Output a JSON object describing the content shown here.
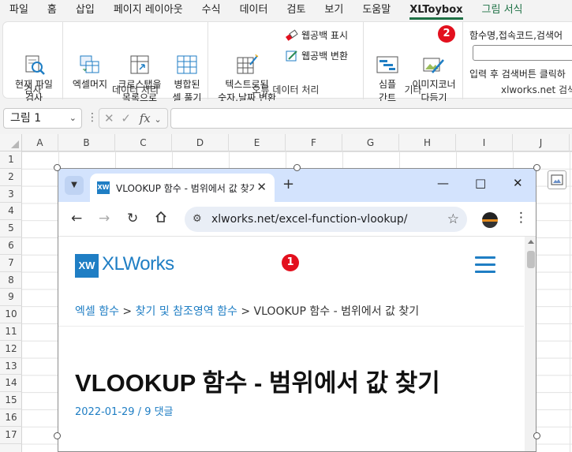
{
  "menu": {
    "items": [
      "파일",
      "홈",
      "삽입",
      "페이지 레이아웃",
      "수식",
      "데이터",
      "검토",
      "보기",
      "도움말",
      "XLToybox",
      "그림 서식"
    ]
  },
  "ribbon": {
    "search_group": {
      "button": "현재 파일\n검사",
      "label": "검사"
    },
    "data_group": {
      "buttons": [
        "엑셀머지",
        "크로스탭을\n목록으로",
        "병합된\n셀 풀기"
      ],
      "label": "데이터 처리"
    },
    "error_group": {
      "big_button": "텍스트로된\n숫자,날짜 변환",
      "small_buttons": [
        "웹공백 표시",
        "웹공백 변환"
      ],
      "label": "오류 데이터 처리"
    },
    "etc_group": {
      "buttons": [
        "심플\n간트",
        "이미지코너\n다듬기"
      ],
      "label": "기타"
    },
    "xlworks_group": {
      "heading": "함수명,접속코드,검색어",
      "hint": "입력 후 검색버튼 클릭하",
      "label": "xlworks.net 검색"
    }
  },
  "badges": {
    "image_corner": "2",
    "picture": "1"
  },
  "formula_bar": {
    "name_box": "그림 1",
    "fx": "fx",
    "formula": ""
  },
  "grid": {
    "columns": [
      "A",
      "B",
      "C",
      "D",
      "E",
      "F",
      "G",
      "H",
      "I",
      "J"
    ],
    "rows": [
      "1",
      "2",
      "3",
      "4",
      "5",
      "6",
      "7",
      "8",
      "9",
      "10",
      "11",
      "12",
      "13",
      "14",
      "15",
      "16",
      "17"
    ]
  },
  "browser": {
    "tab_favicon": "XW",
    "tab_title": "VLOOKUP 함수 - 범위에서 값 찾기",
    "url": "xlworks.net/excel-function-vlookup/",
    "page": {
      "logo_mark": "XW",
      "logo_text": "XLWorks",
      "breadcrumb": {
        "link1": "엑셀 함수",
        "sep": " > ",
        "link2": "찾기 및 참조영역 함수",
        "current": "VLOOKUP 함수 - 범위에서 값 찾기"
      },
      "title": "VLOOKUP 함수 - 범위에서 값 찾기",
      "meta": "2022-01-29 / 9 댓글"
    }
  }
}
